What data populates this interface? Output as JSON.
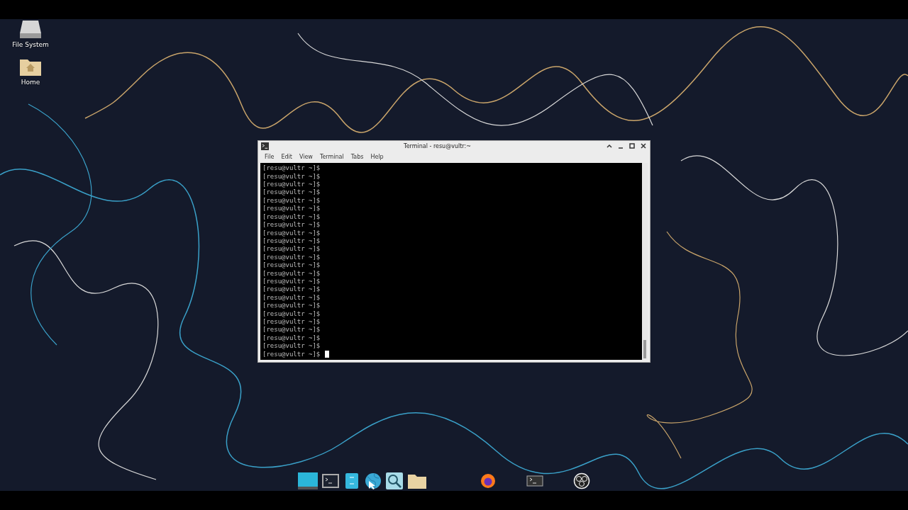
{
  "desktop_icons": [
    {
      "kind": "drive",
      "label": "File System"
    },
    {
      "kind": "folder",
      "label": "Home"
    }
  ],
  "window": {
    "title": "Terminal - resu@vultr:~",
    "menu": [
      "File",
      "Edit",
      "View",
      "Terminal",
      "Tabs",
      "Help"
    ]
  },
  "terminal": {
    "lines": [
      "[resu@vultr ~]$",
      "[resu@vultr ~]$",
      "[resu@vultr ~]$",
      "[resu@vultr ~]$",
      "[resu@vultr ~]$",
      "[resu@vultr ~]$",
      "[resu@vultr ~]$",
      "[resu@vultr ~]$",
      "[resu@vultr ~]$",
      "[resu@vultr ~]$",
      "[resu@vultr ~]$",
      "[resu@vultr ~]$",
      "[resu@vultr ~]$",
      "[resu@vultr ~]$",
      "[resu@vultr ~]$",
      "[resu@vultr ~]$",
      "[resu@vultr ~]$",
      "[resu@vultr ~]$",
      "[resu@vultr ~]$",
      "[resu@vultr ~]$",
      "[resu@vultr ~]$",
      "[resu@vultr ~]$",
      "[resu@vultr ~]$",
      "[resu@vultr ~]$"
    ]
  }
}
